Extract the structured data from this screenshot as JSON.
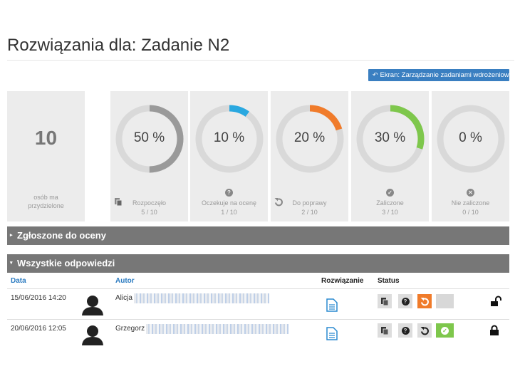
{
  "page_title": "Rozwiązania dla: Zadanie N2",
  "back_button": "Ekran: Zarządzanie zadaniami wdrożeniowymi",
  "assigned": {
    "value": "10",
    "label": "osób ma przydzielone"
  },
  "stats": [
    {
      "percent": "50 %",
      "fraction": 0.5,
      "label": "Rozpoczęło",
      "count": "5 / 10",
      "color": "#9a9a9a",
      "icon": "copy-icon"
    },
    {
      "percent": "10 %",
      "fraction": 0.1,
      "label": "Oczekuje na ocenę",
      "count": "1 / 10",
      "color": "#2aa8e0",
      "icon": "question-icon"
    },
    {
      "percent": "20 %",
      "fraction": 0.2,
      "label": "Do poprawy",
      "count": "2 / 10",
      "color": "#f07b2a",
      "icon": "undo-icon"
    },
    {
      "percent": "30 %",
      "fraction": 0.3,
      "label": "Zaliczone",
      "count": "3 / 10",
      "color": "#7ec74c",
      "icon": "check-icon"
    },
    {
      "percent": "0 %",
      "fraction": 0.0,
      "label": "Nie zaliczone",
      "count": "0 / 10",
      "color": "#d9d9d9",
      "icon": "cross-icon"
    }
  ],
  "sections": {
    "submitted": "Zgłoszone do oceny",
    "all": "Wszystkie odpowiedzi"
  },
  "table": {
    "headers": {
      "date": "Data",
      "author": "Autor",
      "solution": "Rozwiązanie",
      "status": "Status"
    },
    "rows": [
      {
        "date": "15/06/2016 14:20",
        "author": "Alicja",
        "locked": false
      },
      {
        "date": "20/06/2016 12:05",
        "author": "Grzegorz",
        "locked": true
      }
    ]
  },
  "colors": {
    "accent": "#3a7fc1",
    "bar": "#777777",
    "orange": "#f07b2a",
    "green": "#7ec74c",
    "blue": "#2aa8e0"
  }
}
